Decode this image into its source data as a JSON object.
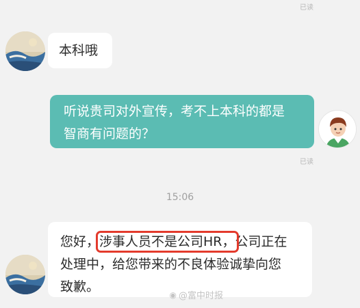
{
  "chat": {
    "messages": [
      {
        "side": "in",
        "text": "本科哦"
      },
      {
        "side": "out",
        "line1": "听说贵司对外宣传，考不上本科的都是",
        "line2": "智商有问题的？"
      },
      {
        "side": "in",
        "lead": "您好，",
        "highlight": "涉事人员不是公司HR，",
        "tail1": "公司正在",
        "line2": "处理中，给您带来的不良体验诚挚向您",
        "line3": "致歉。"
      }
    ],
    "read_top": "已读",
    "read_mid": "已读",
    "timestamp": "15:06",
    "watermark": "@富中时报",
    "highlight_color": "#e33a2c",
    "bubble_out_color": "#5bbcb3"
  }
}
